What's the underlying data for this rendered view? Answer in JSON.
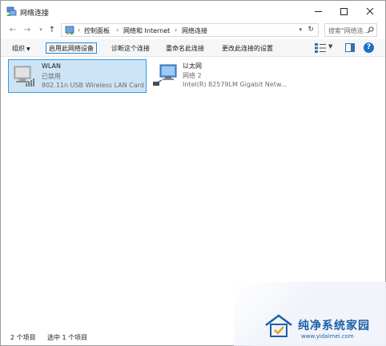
{
  "window": {
    "title": "网络连接",
    "app_icon": "network-connections-icon"
  },
  "address": {
    "crumbs": [
      "控制面板",
      "网络和 Internet",
      "网络连接"
    ],
    "search_placeholder": "搜索\"网络连..."
  },
  "toolbar": {
    "organize": "组织",
    "enable_device": "启用此网络设备",
    "diagnose": "诊断这个连接",
    "rename": "重命名此连接",
    "change_settings": "更改此连接的设置"
  },
  "items": [
    {
      "name": "WLAN",
      "status": "已禁用",
      "device": "802.11n USB Wireless LAN Card",
      "icon": "wireless-adapter-disabled-icon",
      "selected": true
    },
    {
      "name": "以太网",
      "status": "网络 2",
      "device": "Intel(R) 82579LM Gigabit Netw...",
      "icon": "ethernet-adapter-icon",
      "selected": false
    }
  ],
  "statusbar": {
    "count": "2 个项目",
    "selected": "选中 1 个项目"
  },
  "watermark": {
    "name": "纯净系统家园",
    "url": "www.yidaimei.com"
  },
  "colors": {
    "selection_bg": "#cce4f6",
    "selection_border": "#3399e6",
    "watermark": "#1b5fa8"
  }
}
